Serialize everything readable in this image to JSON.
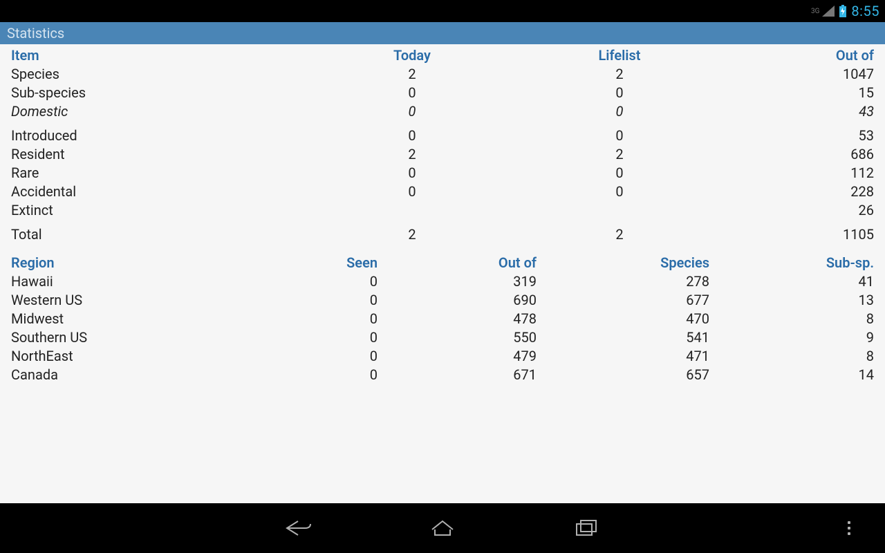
{
  "statusbar": {
    "network": "3G",
    "time": "8:55"
  },
  "titlebar": {
    "title": "Statistics"
  },
  "items": {
    "headers": {
      "item": "Item",
      "today": "Today",
      "lifelist": "Lifelist",
      "outof": "Out of"
    },
    "rows": [
      {
        "label": "Species",
        "today": "2",
        "lifelist": "2",
        "outof": "1047",
        "italic": false
      },
      {
        "label": "Sub-species",
        "today": "0",
        "lifelist": "0",
        "outof": "15",
        "italic": false
      },
      {
        "label": "Domestic",
        "today": "0",
        "lifelist": "0",
        "outof": "43",
        "italic": true
      }
    ],
    "rows2": [
      {
        "label": "Introduced",
        "today": "0",
        "lifelist": "0",
        "outof": "53"
      },
      {
        "label": "Resident",
        "today": "2",
        "lifelist": "2",
        "outof": "686"
      },
      {
        "label": "Rare",
        "today": "0",
        "lifelist": "0",
        "outof": "112"
      },
      {
        "label": "Accidental",
        "today": "0",
        "lifelist": "0",
        "outof": "228"
      },
      {
        "label": "Extinct",
        "today": "",
        "lifelist": "",
        "outof": "26"
      }
    ],
    "total": {
      "label": "Total",
      "today": "2",
      "lifelist": "2",
      "outof": "1105"
    }
  },
  "regions": {
    "headers": {
      "region": "Region",
      "seen": "Seen",
      "outof": "Out of",
      "species": "Species",
      "subsp": "Sub-sp."
    },
    "rows": [
      {
        "label": "Hawaii",
        "seen": "0",
        "outof": "319",
        "species": "278",
        "subsp": "41"
      },
      {
        "label": "Western US",
        "seen": "0",
        "outof": "690",
        "species": "677",
        "subsp": "13"
      },
      {
        "label": "Midwest",
        "seen": "0",
        "outof": "478",
        "species": "470",
        "subsp": "8"
      },
      {
        "label": "Southern US",
        "seen": "0",
        "outof": "550",
        "species": "541",
        "subsp": "9"
      },
      {
        "label": "NorthEast",
        "seen": "0",
        "outof": "479",
        "species": "471",
        "subsp": "8"
      },
      {
        "label": "Canada",
        "seen": "0",
        "outof": "671",
        "species": "657",
        "subsp": "14"
      }
    ]
  }
}
